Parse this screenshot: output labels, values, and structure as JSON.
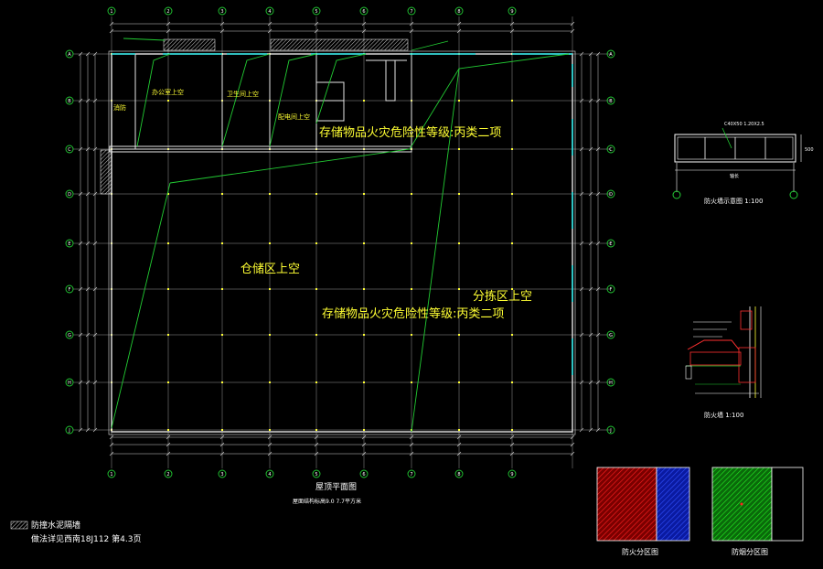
{
  "grid_cols": [
    "1",
    "2",
    "3",
    "4",
    "5",
    "6",
    "7",
    "8",
    "9"
  ],
  "grid_rows": [
    "A",
    "B",
    "C",
    "D",
    "E",
    "F",
    "G",
    "H",
    "J"
  ],
  "zones": {
    "storage_upper": "仓储区上空",
    "hazard_class_top": "存储物品火灾危险性等级:丙类二项",
    "hazard_class_mid": "存储物品火灾危险性等级:丙类二项",
    "sorting_upper": "分拣区上空",
    "room1_upper": "办公室上空",
    "room2_upper": "卫生间上空",
    "room3_upper": "配电间上空",
    "left_label": "消防"
  },
  "titles": {
    "roof_plan": "屋顶平面图",
    "roof_plan_note": "屋面结构标高9.0 7.7平方米",
    "section_detail_a": "防火墙示意图 1:100",
    "section_detail_b": "防火墙 1:100",
    "fire_zone": "防火分区图",
    "smoke_zone": "防烟分区图"
  },
  "section_a": {
    "callout": "C40X50 1.20X2.5",
    "dim": "500",
    "bottom_dim": "轴长"
  },
  "legend": {
    "hatch_label": "防撞水泥隔墙",
    "note": "做法详见西南18J112 第4.3页"
  },
  "colors": {
    "grid_line": "#9a9a9a",
    "wall": "#e6e6e6",
    "leader": "#22cc33",
    "text": "#ffff33",
    "fire_red": "#d01515",
    "fire_blue": "#1830e0",
    "smoke_green": "#15c515",
    "cyan": "#22dddd"
  }
}
